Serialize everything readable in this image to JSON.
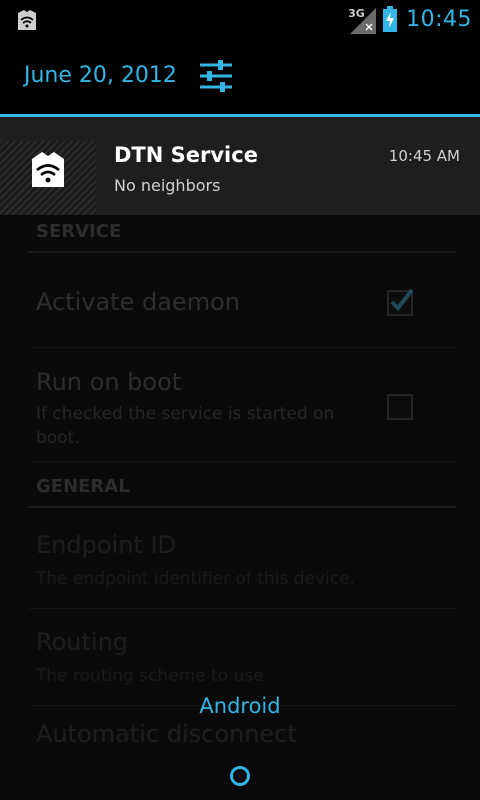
{
  "status_bar": {
    "network_type": "3G",
    "time": "10:45",
    "notification_icon": "dtn-app-icon",
    "signal_icon": "signal-no-data-icon",
    "battery_icon": "battery-charging-icon"
  },
  "shade": {
    "date": "June 20, 2012",
    "settings_icon": "sliders-icon"
  },
  "notification": {
    "icon": "dtn-app-icon",
    "title": "DTN Service",
    "text": "No neighbors",
    "time": "10:45 AM"
  },
  "settings": {
    "categories": [
      {
        "label": "SERVICE"
      },
      {
        "label": "GENERAL"
      }
    ],
    "service_prefs": [
      {
        "title": "Activate daemon",
        "summary": "",
        "checked": true
      },
      {
        "title": "Run on boot",
        "summary": "If checked the service is started on boot.",
        "checked": false
      }
    ],
    "general_prefs": [
      {
        "title": "Endpoint ID",
        "summary": "The endpoint identifier of this device."
      },
      {
        "title": "Routing",
        "summary": "The routing scheme to use."
      },
      {
        "title": "Automatic disconnect",
        "summary": ""
      }
    ]
  },
  "footer": {
    "carrier_label": "Android"
  },
  "colors": {
    "accent": "#33b5e5",
    "background": "#000000",
    "notification_bg": "#1e1e1e"
  }
}
